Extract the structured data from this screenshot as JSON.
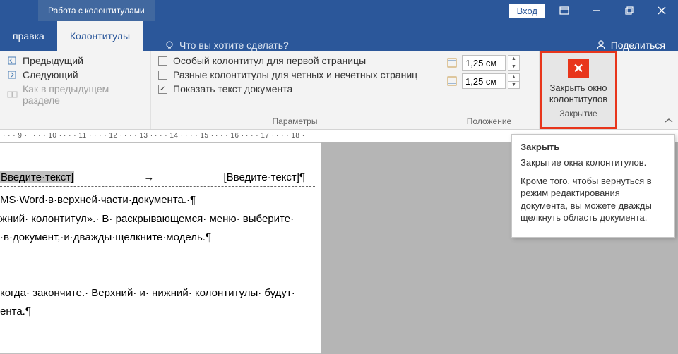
{
  "titlebar": {
    "context_title": "Работа с колонтитулами",
    "login": "Вход"
  },
  "tabs": {
    "pravka": "правка",
    "active": "Колонтитулы",
    "tell_me": "Что вы хотите сделать?",
    "share": "Поделиться"
  },
  "ribbon": {
    "nav": {
      "prev": "Предыдущий",
      "next": "Следующий",
      "as_prev": "Как в предыдущем разделе"
    },
    "params": {
      "opt1": "Особый колонтитул для первой страницы",
      "opt2": "Разные колонтитулы для четных и нечетных страниц",
      "opt3": "Показать текст документа",
      "label": "Параметры"
    },
    "position": {
      "top": "1,25 см",
      "bottom": "1,25 см",
      "label": "Положение"
    },
    "close": {
      "line1": "Закрыть окно",
      "line2": "колонтитулов",
      "group": "Закрытие"
    }
  },
  "tooltip": {
    "title": "Закрыть",
    "p1": "Закрытие окна колонтитулов.",
    "p2": "Кроме того, чтобы вернуться в режим редактирования документа, вы можете дважды щелкнуть область документа."
  },
  "doc": {
    "hdr_left": "Введите·текст]",
    "hdr_arrow": "→",
    "hdr_right": "[Введите·текст]¶",
    "l1": "MS·Word·в·верхней·части·документа.·¶",
    "l2": "жний· колонтитул».· В· раскрывающемся· меню· выберите·",
    "l3": "·в·документ,·и·дважды·щелкните·модель.¶",
    "l4": "когда· закончите.· Верхний· и· нижний· колонтитулы· будут·",
    "l5": "ента.¶"
  },
  "ruler_marks": [
    "9",
    "10",
    "11",
    "12",
    "13",
    "14",
    "15",
    "16",
    "17",
    "18"
  ]
}
